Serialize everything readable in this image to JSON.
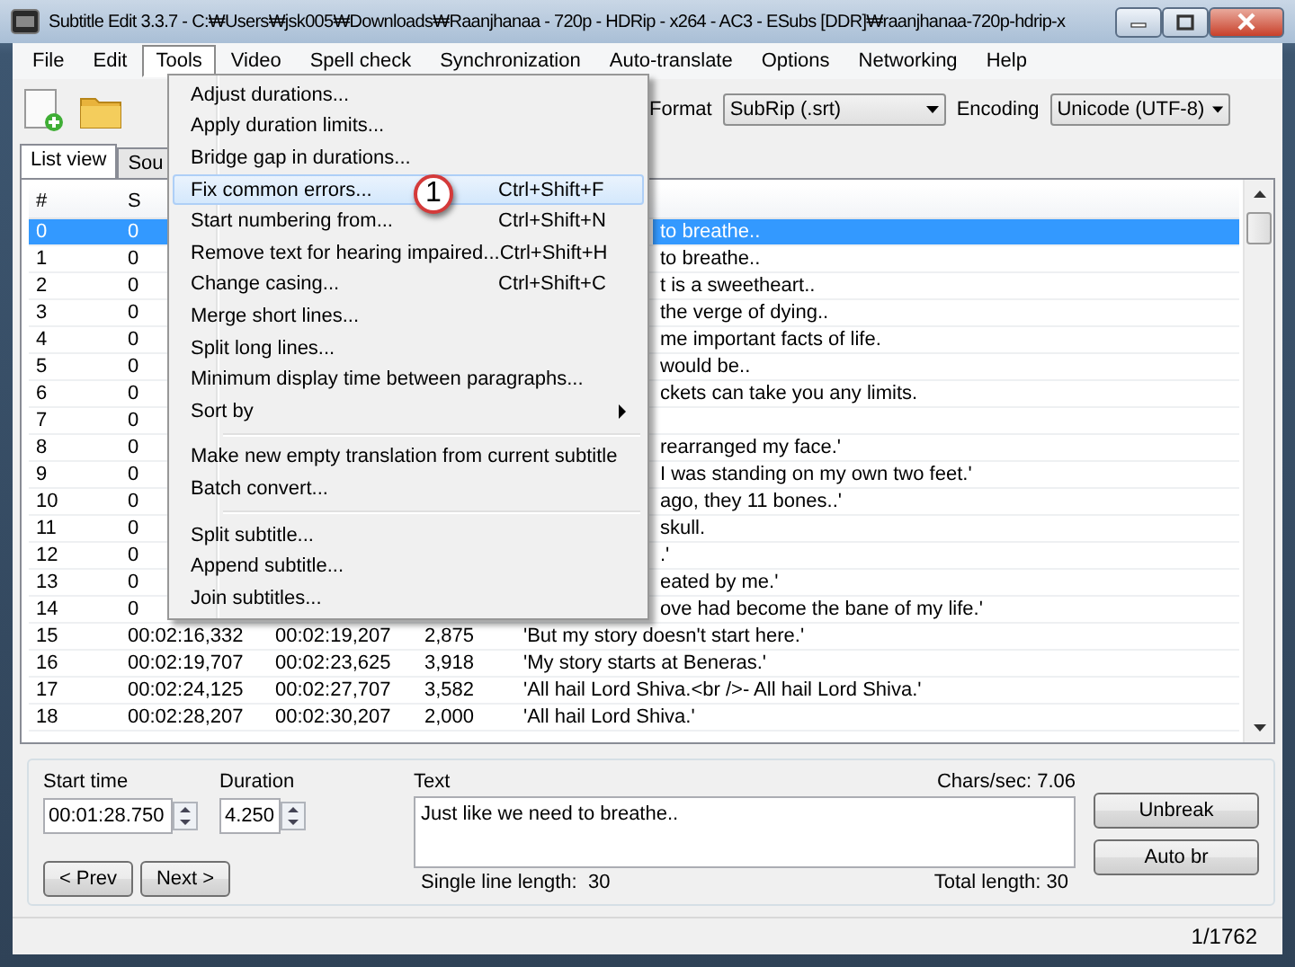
{
  "window": {
    "title": "Subtitle Edit 3.3.7 - C:₩Users₩jsk005₩Downloads₩Raanjhanaa - 720p - HDRip - x264 - AC3 - ESubs [DDR]₩raanjhanaa-720p-hdrip-x"
  },
  "menu_bar": [
    {
      "label": "File",
      "selected": false
    },
    {
      "label": "Edit",
      "selected": false
    },
    {
      "label": "Tools",
      "selected": true
    },
    {
      "label": "Video",
      "selected": false
    },
    {
      "label": "Spell check",
      "selected": false
    },
    {
      "label": "Synchronization",
      "selected": false
    },
    {
      "label": "Auto-translate",
      "selected": false
    },
    {
      "label": "Options",
      "selected": false
    },
    {
      "label": "Networking",
      "selected": false
    },
    {
      "label": "Help",
      "selected": false
    }
  ],
  "toolbar": {
    "format": {
      "label": "Format",
      "value": "SubRip (.srt)"
    },
    "encoding": {
      "label": "Encoding",
      "value": "Unicode (UTF-8)"
    }
  },
  "tabs": [
    {
      "label": "List view",
      "selected": true
    },
    {
      "label": "Sou",
      "selected": false
    }
  ],
  "table": {
    "columns": [
      "#",
      "S"
    ],
    "rows": [
      {
        "kind": "partial",
        "number": "0",
        "start": "0",
        "text": "to breathe..",
        "selected": true
      },
      {
        "kind": "partial",
        "number": "1",
        "start": "0",
        "text": "to breathe..",
        "selected": false
      },
      {
        "kind": "partial",
        "number": "2",
        "start": "0",
        "text": "t is a sweetheart..",
        "selected": false
      },
      {
        "kind": "partial",
        "number": "3",
        "start": "0",
        "text": "the verge of dying..",
        "selected": false
      },
      {
        "kind": "partial",
        "number": "4",
        "start": "0",
        "text": "me important facts of life.",
        "selected": false
      },
      {
        "kind": "partial",
        "number": "5",
        "start": "0",
        "text": "would be..",
        "selected": false
      },
      {
        "kind": "partial",
        "number": "6",
        "start": "0",
        "text": "ckets can take you any limits.",
        "selected": false
      },
      {
        "kind": "partial",
        "number": "7",
        "start": "0",
        "selected": false
      },
      {
        "kind": "partial",
        "number": "8",
        "start": "0",
        "text": "rearranged my face.'",
        "selected": false
      },
      {
        "kind": "partial",
        "number": "9",
        "start": "0",
        "text": "I was standing on my own two feet.'",
        "selected": false
      },
      {
        "kind": "partial",
        "number": "10",
        "start": "0",
        "text": "ago, they 11 bones..'",
        "selected": false
      },
      {
        "kind": "partial",
        "number": "11",
        "start": "0",
        "text": "skull.",
        "selected": false
      },
      {
        "kind": "partial",
        "number": "12",
        "start": "0",
        "text": ".'",
        "selected": false
      },
      {
        "kind": "partial",
        "number": "13",
        "start": "0",
        "text": "eated by me.'",
        "selected": false
      },
      {
        "kind": "partial",
        "number": "14",
        "start": "0",
        "text": "ove had become the bane of my life.'",
        "selected": false
      },
      {
        "kind": "full",
        "number": "15",
        "start": "00:02:16,332",
        "end": "00:02:19,207",
        "duration": "2,875",
        "text": "'But my story doesn't start here.'",
        "selected": false
      },
      {
        "kind": "full",
        "number": "16",
        "start": "00:02:19,707",
        "end": "00:02:23,625",
        "duration": "3,918",
        "text": "'My story starts at Beneras.'",
        "selected": false
      },
      {
        "kind": "full",
        "number": "17",
        "start": "00:02:24,125",
        "end": "00:02:27,707",
        "duration": "3,582",
        "text": "'All hail Lord Shiva.<br />- All hail Lord Shiva.'",
        "selected": false
      },
      {
        "kind": "full",
        "number": "18",
        "start": "00:02:28,207",
        "end": "00:02:30,207",
        "duration": "2,000",
        "text": "'All hail Lord Shiva.'",
        "selected": false
      }
    ]
  },
  "tools_menu": {
    "groups": [
      {
        "items": [
          {
            "label": "Adjust durations...",
            "selected": false
          },
          {
            "label": "Apply duration limits...",
            "selected": false
          },
          {
            "label": "Bridge gap in durations...",
            "selected": false
          },
          {
            "label": "Fix common errors...",
            "shortcut": "Ctrl+Shift+F",
            "selected": true
          },
          {
            "label": "Start numbering from...",
            "shortcut": "Ctrl+Shift+N",
            "selected": false
          },
          {
            "label": "Remove text for hearing impaired...",
            "shortcut": "Ctrl+Shift+H",
            "selected": false
          },
          {
            "label": "Change casing...",
            "shortcut": "Ctrl+Shift+C",
            "selected": false
          },
          {
            "label": "Merge short lines...",
            "selected": false
          },
          {
            "label": "Split long lines...",
            "selected": false
          },
          {
            "label": "Minimum display time between paragraphs...",
            "selected": false
          },
          {
            "label": "Sort by",
            "selected": false,
            "submenu": true
          }
        ]
      },
      {
        "items": [
          {
            "label": "Make new empty translation from current subtitle",
            "selected": false
          },
          {
            "label": "Batch convert...",
            "selected": false
          }
        ]
      },
      {
        "items": [
          {
            "label": "Split subtitle...",
            "selected": false
          },
          {
            "label": "Append subtitle...",
            "selected": false
          },
          {
            "label": "Join subtitles...",
            "selected": false
          }
        ]
      }
    ]
  },
  "callout": {
    "label": "1"
  },
  "editor": {
    "start_time": {
      "label": "Start time",
      "value": "00:01:28.750"
    },
    "duration": {
      "label": "Duration",
      "value": "4.250"
    },
    "text": {
      "label": "Text",
      "value": "Just like we need to breathe.."
    },
    "chars_per_sec": "Chars/sec: 7.06",
    "single_line_length": "Single line length:  30",
    "total_length": "Total length: 30",
    "prev_button": "< Prev",
    "next_button": "Next >",
    "unbreak_button": "Unbreak",
    "auto_br_button": "Auto br"
  },
  "status_bar": {
    "position": "1/1762"
  }
}
